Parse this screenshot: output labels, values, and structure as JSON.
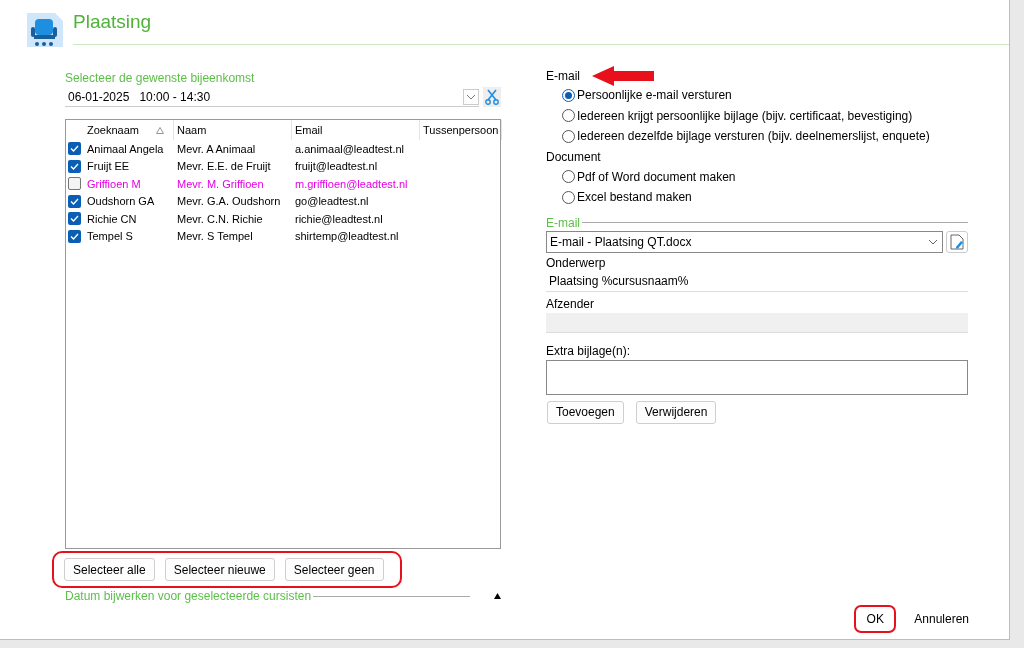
{
  "header": {
    "title": "Plaatsing"
  },
  "meeting": {
    "label": "Selecteer de gewenste bijeenkomst",
    "value": "06-01-2025   10:00 - 14:30"
  },
  "table": {
    "columns": [
      "Zoeknaam",
      "Naam",
      "Email",
      "Tussenpersoon"
    ],
    "rows": [
      {
        "checked": true,
        "highlighted": false,
        "cells": [
          "Animaal Angela",
          "Mevr. A Animaal",
          "a.animaal@leadtest.nl"
        ]
      },
      {
        "checked": true,
        "highlighted": false,
        "cells": [
          "Fruijt EE",
          "Mevr. E.E. de Fruijt",
          "fruijt@leadtest.nl"
        ]
      },
      {
        "checked": false,
        "highlighted": true,
        "cells": [
          "Griffioen M",
          "Mevr. M. Griffioen",
          "m.griffioen@leadtest.nl"
        ]
      },
      {
        "checked": true,
        "highlighted": false,
        "cells": [
          "Oudshorn GA",
          "Mevr. G.A. Oudshorn",
          "go@leadtest.nl"
        ]
      },
      {
        "checked": true,
        "highlighted": false,
        "cells": [
          "Richie CN",
          "Mevr. C.N. Richie",
          "richie@leadtest.nl"
        ]
      },
      {
        "checked": true,
        "highlighted": false,
        "cells": [
          "Tempel S",
          "Mevr. S Tempel",
          "shirtemp@leadtest.nl"
        ]
      }
    ]
  },
  "list_buttons": [
    "Selecteer alle",
    "Selecteer nieuwe",
    "Selecteer geen"
  ],
  "date_section": {
    "label": "Datum bijwerken voor geselecteerde cursisten"
  },
  "mode": {
    "label": "E-mail",
    "options": [
      {
        "label": "Persoonlijke e-mail versturen",
        "selected": true
      },
      {
        "label": "Iedereen krijgt persoonlijke bijlage (bijv. certificaat, bevestiging)",
        "selected": false
      },
      {
        "label": "Iedereen dezelfde bijlage versturen (bijv. deelnemerslijst, enquete)",
        "selected": false
      }
    ]
  },
  "document": {
    "label": "Document",
    "options": [
      {
        "label": "Pdf of Word document maken",
        "selected": false
      },
      {
        "label": "Excel bestand maken",
        "selected": false
      }
    ]
  },
  "email_section": {
    "label": "E-mail",
    "template": "E-mail - Plaatsing QT.docx",
    "subject_label": "Onderwerp",
    "subject": "Plaatsing %cursusnaam%",
    "sender_label": "Afzender",
    "attachments_label": "Extra bijlage(n):"
  },
  "attachment_buttons": [
    "Toevoegen",
    "Verwijderen"
  ],
  "footer_buttons": [
    "OK",
    "Annuleren"
  ]
}
